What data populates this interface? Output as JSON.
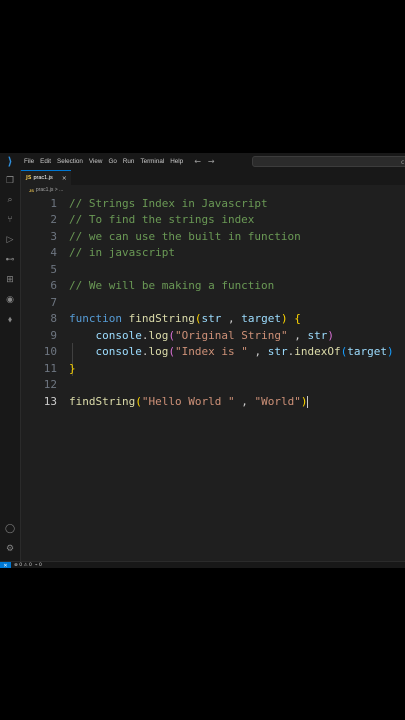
{
  "menu": [
    "File",
    "Edit",
    "Selection",
    "View",
    "Go",
    "Run",
    "Terminal",
    "Help"
  ],
  "nav": {
    "back": "←",
    "forward": "→"
  },
  "search": {
    "text": "c"
  },
  "activity_icons": [
    "files-icon",
    "search-icon",
    "source-control-icon",
    "run-debug-icon",
    "remote-icon",
    "extensions-icon",
    "edge-icon",
    "flask-icon"
  ],
  "bottom_icons": [
    "account-icon",
    "settings-gear-icon"
  ],
  "tab": {
    "label": "prac1.js",
    "icon": "JS",
    "close": "×"
  },
  "breadcrumb": {
    "icon": "JS",
    "label": "prac1.js > ..."
  },
  "colors": {
    "accent": "#0078d4",
    "editor_bg": "#1f1f1f",
    "comment": "#6a9955",
    "keyword": "#569cd6",
    "function": "#dcdcaa",
    "string": "#ce9178"
  },
  "editor": {
    "active_line": 13,
    "lines": [
      {
        "n": "1",
        "tokens": [
          {
            "t": "// Strings Index in Javascript",
            "c": "c-comment"
          }
        ]
      },
      {
        "n": "2",
        "tokens": [
          {
            "t": "// To find the strings index",
            "c": "c-comment"
          }
        ]
      },
      {
        "n": "3",
        "tokens": [
          {
            "t": "// we can use the built in function",
            "c": "c-comment"
          }
        ]
      },
      {
        "n": "4",
        "tokens": [
          {
            "t": "// in javascript",
            "c": "c-comment"
          }
        ]
      },
      {
        "n": "5",
        "tokens": []
      },
      {
        "n": "6",
        "tokens": [
          {
            "t": "// We will be making a function",
            "c": "c-comment"
          }
        ]
      },
      {
        "n": "7",
        "tokens": []
      },
      {
        "n": "8",
        "tokens": [
          {
            "t": "function",
            "c": "c-kw"
          },
          {
            "t": " ",
            "c": "c-plain"
          },
          {
            "t": "findString",
            "c": "c-fn"
          },
          {
            "t": "(",
            "c": "c-b1"
          },
          {
            "t": "str",
            "c": "c-param"
          },
          {
            "t": " , ",
            "c": "c-plain"
          },
          {
            "t": "target",
            "c": "c-param"
          },
          {
            "t": ")",
            "c": "c-b1"
          },
          {
            "t": " ",
            "c": "c-plain"
          },
          {
            "t": "{",
            "c": "c-b1"
          }
        ]
      },
      {
        "n": "9",
        "tokens": [
          {
            "t": "    ",
            "c": "c-plain"
          },
          {
            "t": "console",
            "c": "c-param"
          },
          {
            "t": ".",
            "c": "c-plain"
          },
          {
            "t": "log",
            "c": "c-fn"
          },
          {
            "t": "(",
            "c": "c-b2"
          },
          {
            "t": "\"Original String\"",
            "c": "c-str"
          },
          {
            "t": " , ",
            "c": "c-plain"
          },
          {
            "t": "str",
            "c": "c-param"
          },
          {
            "t": ")",
            "c": "c-b2"
          }
        ]
      },
      {
        "n": "10",
        "tokens": [
          {
            "t": "    ",
            "c": "c-plain"
          },
          {
            "t": "console",
            "c": "c-param"
          },
          {
            "t": ".",
            "c": "c-plain"
          },
          {
            "t": "log",
            "c": "c-fn"
          },
          {
            "t": "(",
            "c": "c-b2"
          },
          {
            "t": "\"Index is \"",
            "c": "c-str"
          },
          {
            "t": " , ",
            "c": "c-plain"
          },
          {
            "t": "str",
            "c": "c-param"
          },
          {
            "t": ".",
            "c": "c-plain"
          },
          {
            "t": "indexOf",
            "c": "c-fn"
          },
          {
            "t": "(",
            "c": "c-b3"
          },
          {
            "t": "target",
            "c": "c-param"
          },
          {
            "t": ")",
            "c": "c-b3"
          }
        ]
      },
      {
        "n": "11",
        "tokens": [
          {
            "t": "}",
            "c": "c-b1"
          }
        ]
      },
      {
        "n": "12",
        "tokens": []
      },
      {
        "n": "13",
        "tokens": [
          {
            "t": "findString",
            "c": "c-fn"
          },
          {
            "t": "(",
            "c": "c-b1"
          },
          {
            "t": "\"Hello World \"",
            "c": "c-str"
          },
          {
            "t": " , ",
            "c": "c-plain"
          },
          {
            "t": "\"World\"",
            "c": "c-str"
          },
          {
            "t": ")",
            "c": "c-b1"
          }
        ]
      }
    ]
  },
  "status": {
    "remote": "✕",
    "problems": "⊗ 0 ⚠ 0",
    "ports": "⌁ 0"
  }
}
